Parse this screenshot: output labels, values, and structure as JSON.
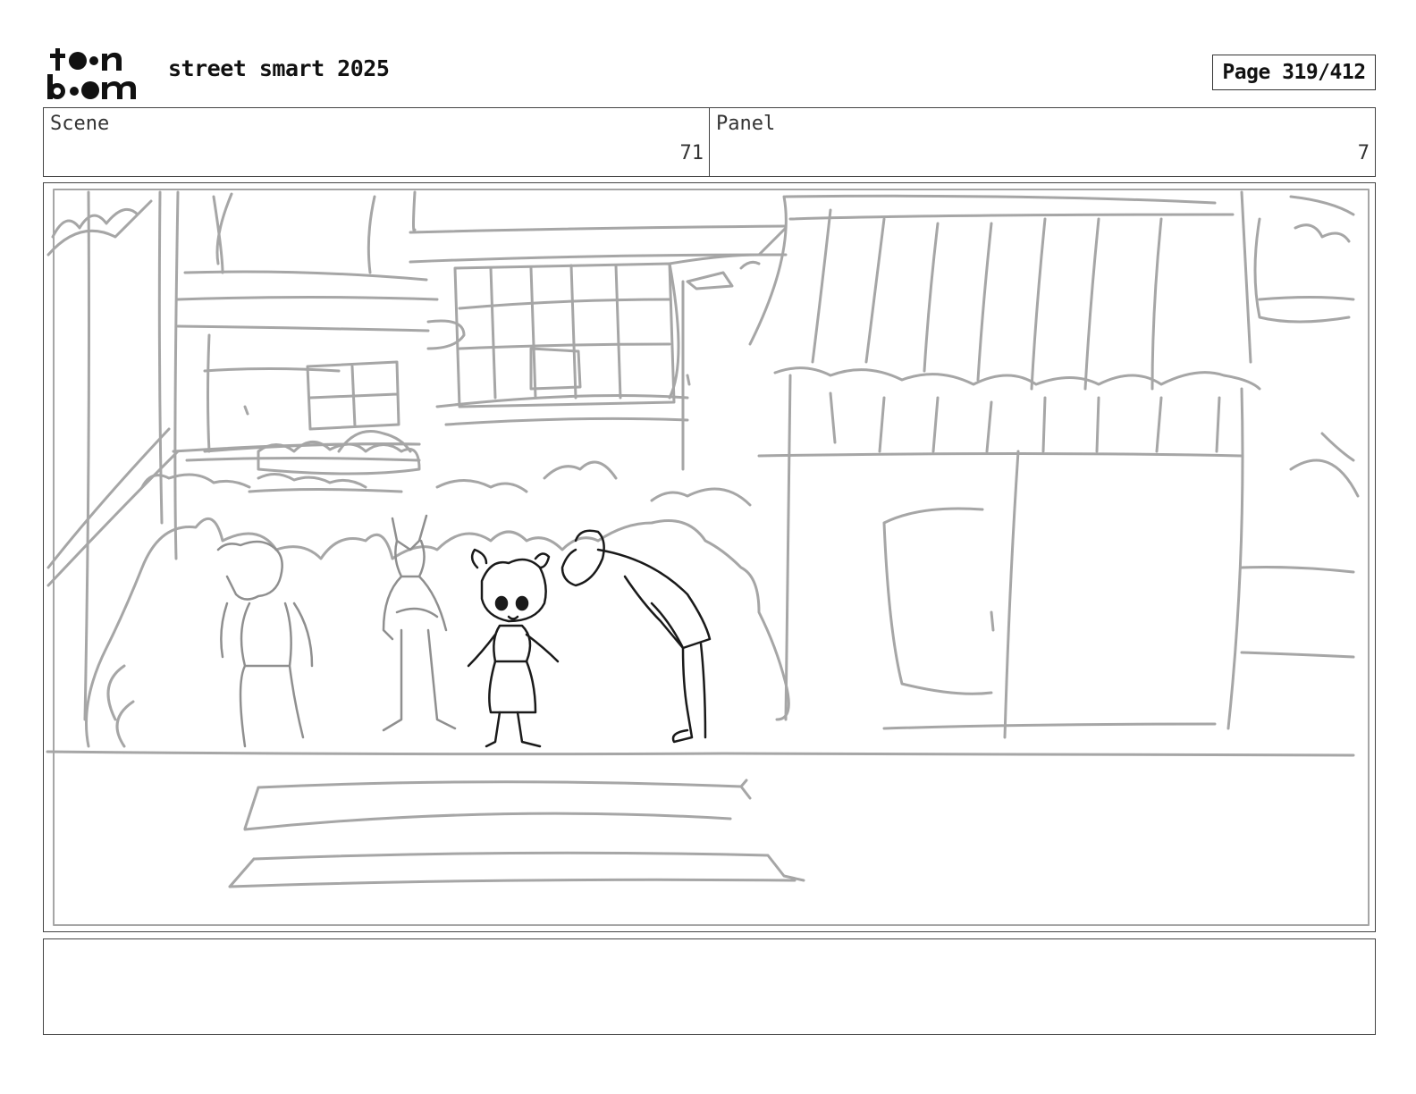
{
  "header": {
    "logo_text": "toon boom",
    "project_title": "street smart 2025",
    "page_label": "Page 319/412"
  },
  "scene": {
    "label": "Scene",
    "value": "71"
  },
  "panel": {
    "label": "Panel",
    "value": "7"
  },
  "notes": {
    "text": ""
  },
  "colors": {
    "sketch_gray": "#a6a6a6",
    "sketch_black": "#1a1a1a",
    "frame": "#444444"
  }
}
